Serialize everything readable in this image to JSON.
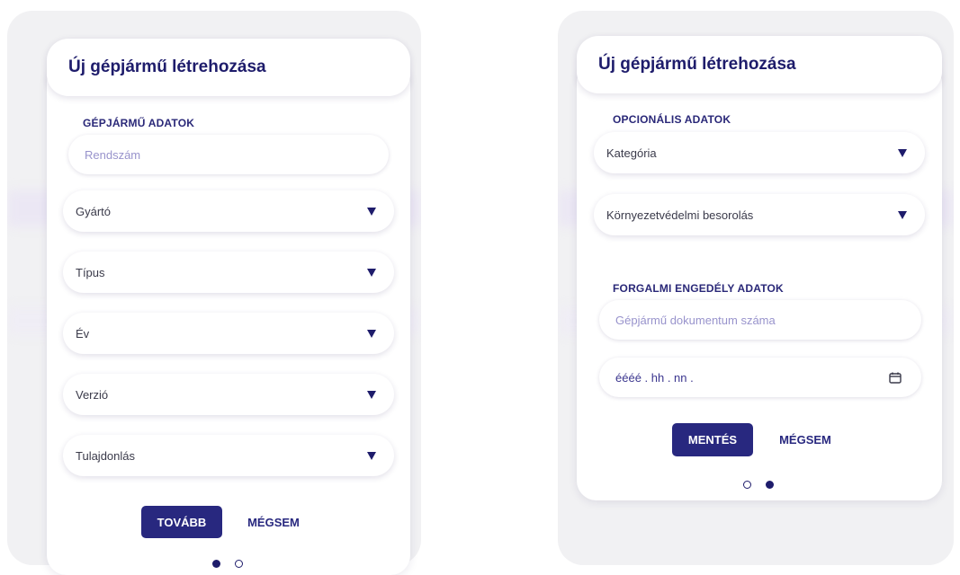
{
  "left": {
    "title": "Új gépjármű létrehozása",
    "section": "GÉPJÁRMŰ ADATOK",
    "plate_placeholder": "Rendszám",
    "selects": [
      "Gyártó",
      "Típus",
      "Év",
      "Verzió",
      "Tulajdonlás"
    ],
    "next_label": "TOVÁBB",
    "cancel_label": "MÉGSEM"
  },
  "right": {
    "title": "Új gépjármű létrehozása",
    "section_optional": "OPCIONÁLIS ADATOK",
    "selects": [
      "Kategória",
      "Környezetvédelmi besorolás"
    ],
    "section_license": "FORGALMI ENGEDÉLY ADATOK",
    "doc_placeholder": "Gépjármű dokumentum száma",
    "date_placeholder": "éééé . hh . nn .",
    "save_label": "MENTÉS",
    "cancel_label": "MÉGSEM"
  },
  "colors": {
    "accent": "#28287f",
    "title": "#1e1c6b",
    "placeholder": "#9893cc"
  },
  "icons": [
    "caret-down-icon",
    "calendar-icon"
  ]
}
